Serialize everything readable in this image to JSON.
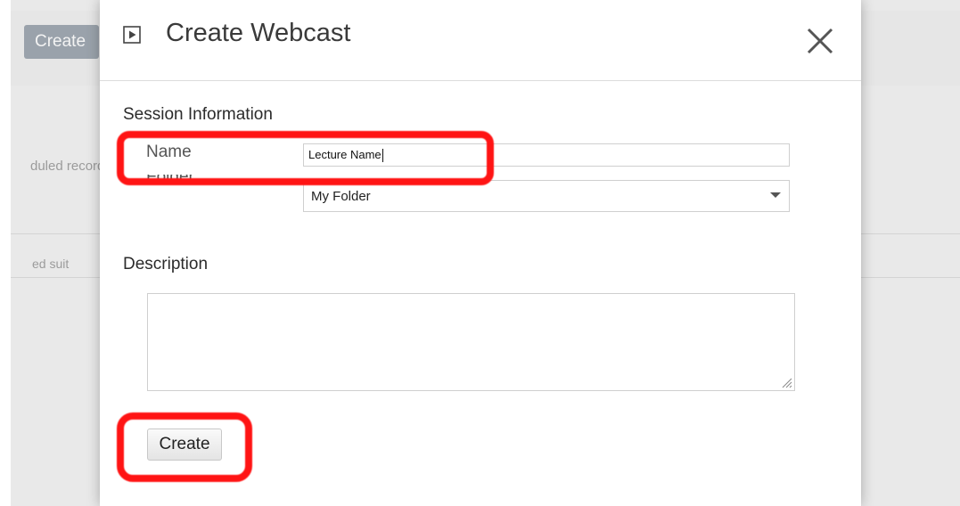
{
  "background": {
    "create_button": "Create",
    "row_text_1": "duled record",
    "row_text_2": "ed suit"
  },
  "modal": {
    "title": "Create Webcast",
    "title_icon": "webcast-icon",
    "close_icon": "close-icon",
    "section_label": "Session Information",
    "name_label": "Name",
    "name_value": "Lecture Name",
    "folder_label": "Folder",
    "folder_selected": "My Folder",
    "description_label": "Description",
    "description_value": "",
    "create_button": "Create"
  },
  "colors": {
    "highlight": "#ff1414",
    "background_dim": "#e9e9e9",
    "bg_button": "#9aa2ab"
  }
}
